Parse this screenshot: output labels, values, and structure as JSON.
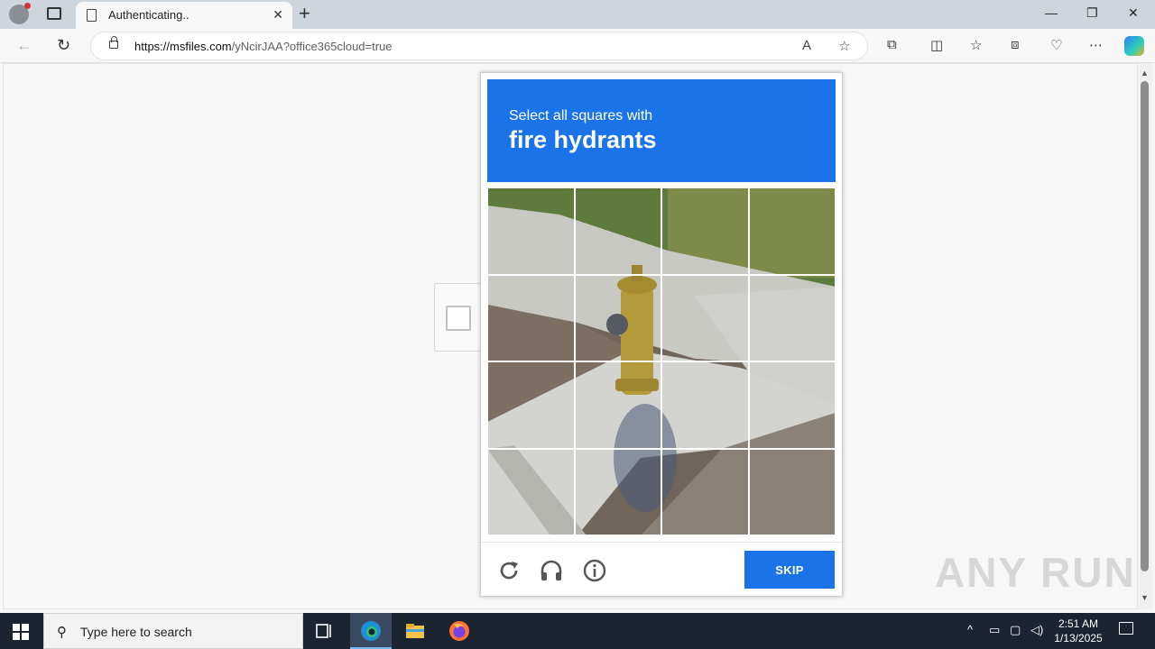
{
  "browser": {
    "tab_title": "Authenticating..",
    "tab_close": "✕",
    "new_tab": "+",
    "url_host": "https://msfiles.com",
    "url_rest": "/yNcirJAA?office365cloud=true",
    "window_controls": {
      "minimize": "—",
      "restore": "❐",
      "close": "✕"
    }
  },
  "captcha": {
    "prompt_line1": "Select all squares with",
    "prompt_line2": "fire hydrants",
    "skip_label": "SKIP",
    "accent_color": "#1a73e8",
    "grid_rows": 4,
    "grid_cols": 4
  },
  "watermark": "ANY RUN",
  "taskbar": {
    "search_placeholder": "Type here to search",
    "time": "2:51 AM",
    "date": "1/13/2025"
  }
}
